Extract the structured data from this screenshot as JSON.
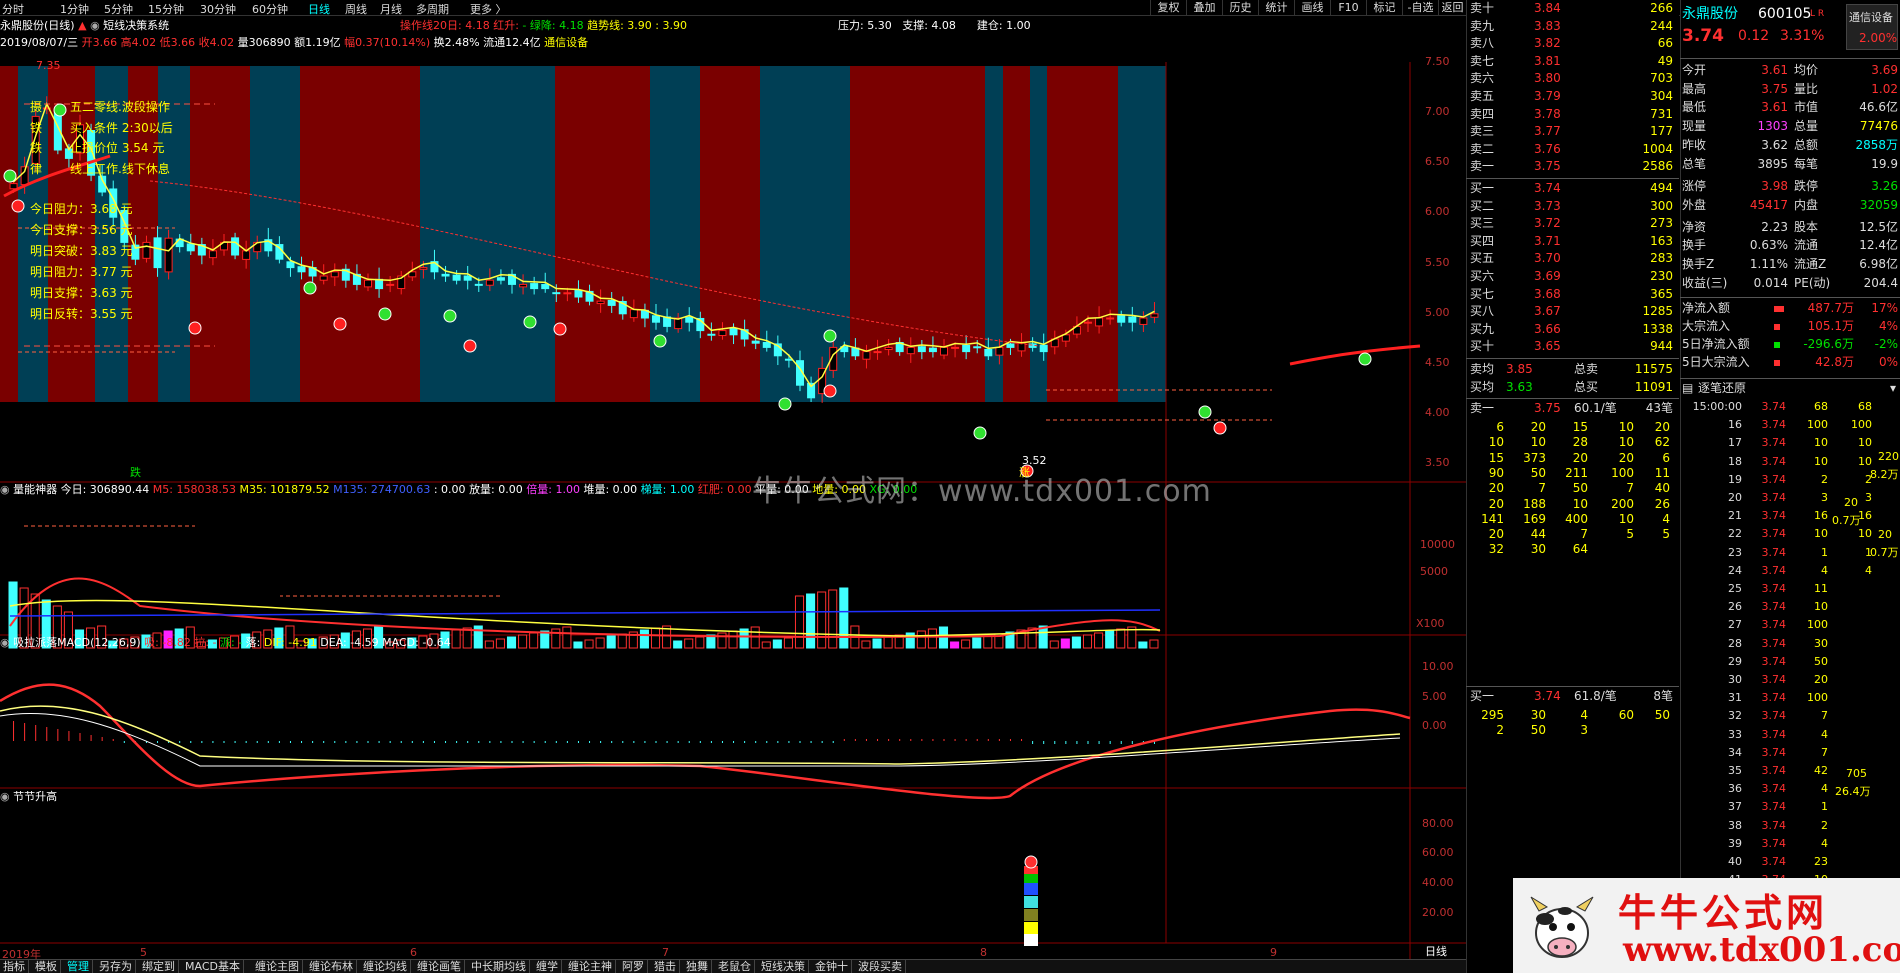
{
  "period_tabs": [
    "分时",
    "1分钟",
    "5分钟",
    "15分钟",
    "30分钟",
    "60分钟",
    "日线",
    "周线",
    "月线",
    "多周期",
    "更多 〉"
  ],
  "active_tab": "日线",
  "right_buttons": [
    "复权",
    "叠加",
    "历史",
    "统计",
    "画线",
    "F10",
    "标记",
    "-自选",
    "返回"
  ],
  "chart_title": {
    "stock": "永鼎股份(日线)",
    "indicator": "短线决策系统",
    "line1": "操作线20日: 4.18",
    "line2": "红升:",
    "line3": "- 绿降: 4.18",
    "line4": "趋势线: 3.90",
    "line5": ": 3.90",
    "pressure": "压力: 5.30",
    "support": "支撑: 4.08",
    "build": "建仓: 1.00"
  },
  "info_line": {
    "date": "2019/08/07/三",
    "open": "开3.66",
    "high": "高4.02",
    "low": "低3.66",
    "close": "收4.02",
    "vol": "量306890",
    "amt": "额1.19亿",
    "chg": "幅0.37(10.14%)",
    "turnover": "换2.48%",
    "circ": "流通12.4亿",
    "board": "通信设备"
  },
  "price_axis": [
    "7.50",
    "7.00",
    "6.50",
    "6.00",
    "5.50",
    "5.00",
    "4.50",
    "4.00",
    "3.50"
  ],
  "annotations": {
    "high": "7.35",
    "low": "3.52",
    "boxtitle": "五二零线.波段操作",
    "buy": "买入条件  2:30以后",
    "stop": "止损价位  3.54 元",
    "online": "线上工作.线下休息",
    "side": [
      "摄",
      "铁",
      "铁",
      "律"
    ],
    "die": "跌",
    "zhang": "涨"
  },
  "levels": [
    {
      "k": "今日阻力：",
      "v": "3.68 元"
    },
    {
      "k": "今日支撑：",
      "v": "3.56 元"
    },
    {
      "k": "明日突破：",
      "v": "3.83 元"
    },
    {
      "k": "明日阻力：",
      "v": "3.77 元"
    },
    {
      "k": "明日支撑：",
      "v": "3.63 元"
    },
    {
      "k": "明日反转：",
      "v": "3.55 元"
    }
  ],
  "vol_header": {
    "name": "量能神器",
    "today": "今日: 306890.44",
    "m5": "M5: 158038.53",
    "m35": "M35: 101879.52",
    "m135": "M135: 274700.63",
    "x1": ": 0.00",
    "fang": "放量: 0.00",
    "bei": "倍量: 1.00",
    "dui": "堆量: 0.00",
    "ti": "梯量: 1.00",
    "hong": "红肥: 0.00",
    "pq": "平量: 0.00",
    "xi": "地量: 0.00",
    "xg": "XG: 0.00"
  },
  "vol_axis": [
    "10000",
    "5000",
    "X100"
  ],
  "macd_header": {
    "name": "吸拉派落MACD(12,26,9)",
    "xi": "吸: -8.82",
    "la": "拉: -",
    "pai": "派: -",
    "luo": "落:",
    "dif": "DIF: -4.91",
    "dea": "DEA: -4.59",
    "macd": "MACD: -0.64"
  },
  "macd_axis": [
    "10.00",
    "5.00",
    "0.00"
  ],
  "jj_header": "节节升高",
  "jj_axis": [
    "80.00",
    "60.00",
    "40.00",
    "20.00"
  ],
  "time_axis": [
    "2019年",
    "5",
    "6",
    "7",
    "8",
    "9"
  ],
  "time_axis_label": "日线",
  "bottom_tabs": [
    "指标",
    "模板",
    "管理",
    "另存为",
    "绑定到",
    "MACD基本",
    "缠论主图",
    "缠论布林",
    "缠论均线",
    "缠论画笔",
    "中长期均线",
    "缠学",
    "缠论主神",
    "阿罗",
    "猎击",
    "独舞",
    "老鼠仓",
    "短线决策",
    "金钟十",
    "波段买卖"
  ],
  "ask_rows": [
    {
      "n": "卖十",
      "p": "3.84",
      "v": "266"
    },
    {
      "n": "卖九",
      "p": "3.83",
      "v": "244"
    },
    {
      "n": "卖八",
      "p": "3.82",
      "v": "66"
    },
    {
      "n": "卖七",
      "p": "3.81",
      "v": "49"
    },
    {
      "n": "卖六",
      "p": "3.80",
      "v": "703"
    },
    {
      "n": "卖五",
      "p": "3.79",
      "v": "304"
    },
    {
      "n": "卖四",
      "p": "3.78",
      "v": "731"
    },
    {
      "n": "卖三",
      "p": "3.77",
      "v": "177"
    },
    {
      "n": "卖二",
      "p": "3.76",
      "v": "1004"
    },
    {
      "n": "卖一",
      "p": "3.75",
      "v": "2586"
    }
  ],
  "bid_rows": [
    {
      "n": "买一",
      "p": "3.74",
      "v": "494"
    },
    {
      "n": "买二",
      "p": "3.73",
      "v": "300"
    },
    {
      "n": "买三",
      "p": "3.72",
      "v": "273"
    },
    {
      "n": "买四",
      "p": "3.71",
      "v": "163"
    },
    {
      "n": "买五",
      "p": "3.70",
      "v": "283"
    },
    {
      "n": "买六",
      "p": "3.69",
      "v": "230"
    },
    {
      "n": "买七",
      "p": "3.68",
      "v": "365"
    },
    {
      "n": "买八",
      "p": "3.67",
      "v": "1285"
    },
    {
      "n": "买九",
      "p": "3.66",
      "v": "1338"
    },
    {
      "n": "买十",
      "p": "3.65",
      "v": "944"
    }
  ],
  "avg_rows": [
    {
      "a": "卖均",
      "b": "3.85",
      "c": "总卖",
      "d": "11575"
    },
    {
      "a": "买均",
      "b": "3.63",
      "c": "总买",
      "d": "11091"
    }
  ],
  "sell1_header": {
    "a": "卖一",
    "b": "3.75",
    "c": "60.1/笔",
    "d": "43笔"
  },
  "sell1_grid": [
    [
      "6",
      "20",
      "15",
      "10",
      "20"
    ],
    [
      "10",
      "10",
      "28",
      "10",
      "62"
    ],
    [
      "15",
      "373",
      "20",
      "20",
      "6"
    ],
    [
      "90",
      "50",
      "211",
      "100",
      "11"
    ],
    [
      "20",
      "7",
      "50",
      "7",
      "40"
    ],
    [
      "20",
      "188",
      "10",
      "200",
      "26"
    ],
    [
      "141",
      "169",
      "400",
      "10",
      "4"
    ],
    [
      "20",
      "44",
      "7",
      "5",
      "5"
    ],
    [
      "32",
      "30",
      "64",
      "",
      ""
    ]
  ],
  "buy1_header": {
    "a": "买一",
    "b": "3.74",
    "c": "61.8/笔",
    "d": "8笔"
  },
  "buy1_grid": [
    [
      "295",
      "30",
      "4",
      "60",
      "50"
    ],
    [
      "2",
      "50",
      "3",
      "",
      ""
    ]
  ],
  "quote": {
    "name": "永鼎股份",
    "code": "600105",
    "lr": "L R",
    "price": "3.74",
    "chg": "0.12",
    "pct": "3.31%",
    "sector": "通信设备",
    "sector_pct": "2.00%"
  },
  "stats": [
    {
      "a": "今开",
      "b": "3.61",
      "c": "均价",
      "d": "3.69"
    },
    {
      "a": "最高",
      "b": "3.75",
      "c": "量比",
      "d": "1.02"
    },
    {
      "a": "最低",
      "b": "3.61",
      "c": "市值",
      "d": "46.6亿"
    },
    {
      "a": "现量",
      "b": "1303",
      "c": "总量",
      "d": "77476"
    },
    {
      "a": "昨收",
      "b": "3.62",
      "c": "总额",
      "d": "2858万"
    },
    {
      "a": "总笔",
      "b": "3895",
      "c": "每笔",
      "d": "19.9"
    },
    {
      "a": "涨停",
      "b": "3.98",
      "c": "跌停",
      "d": "3.26"
    },
    {
      "a": "外盘",
      "b": "45417",
      "c": "内盘",
      "d": "32059"
    },
    {
      "a": "净资",
      "b": "2.23",
      "c": "股本",
      "d": "12.5亿"
    },
    {
      "a": "换手",
      "b": "0.63%",
      "c": "流通",
      "d": "12.4亿"
    },
    {
      "a": "换手Z",
      "b": "1.11%",
      "c": "流通Z",
      "d": "6.98亿"
    },
    {
      "a": "收益(三)",
      "b": "0.014",
      "c": "PE(动)",
      "d": "204.4"
    }
  ],
  "flows": [
    {
      "a": "净流入额",
      "b": "487.7万",
      "c": "17%"
    },
    {
      "a": "大宗流入",
      "b": "105.1万",
      "c": "4%"
    },
    {
      "a": "5日净流入额",
      "b": "-296.6万",
      "c": "-2%"
    },
    {
      "a": "5日大宗流入",
      "b": "42.8万",
      "c": "0%"
    }
  ],
  "tick_title": "逐笔还原",
  "tick_rows": [
    [
      "15:00:00",
      "3.74",
      "68",
      "68"
    ],
    [
      "16",
      "3.74",
      "100",
      "100"
    ],
    [
      "17",
      "3.74",
      "10",
      "10"
    ],
    [
      "18",
      "3.74",
      "10",
      "10"
    ],
    [
      "19",
      "3.74",
      "2",
      "2"
    ],
    [
      "20",
      "3.74",
      "3",
      "3"
    ],
    [
      "21",
      "3.74",
      "16",
      "16"
    ],
    [
      "22",
      "3.74",
      "10",
      "10"
    ],
    [
      "23",
      "3.74",
      "1",
      "1"
    ],
    [
      "24",
      "3.74",
      "4",
      "4"
    ],
    [
      "25",
      "3.74",
      "11",
      ""
    ],
    [
      "26",
      "3.74",
      "10",
      ""
    ],
    [
      "27",
      "3.74",
      "100",
      ""
    ],
    [
      "28",
      "3.74",
      "30",
      ""
    ],
    [
      "29",
      "3.74",
      "50",
      ""
    ],
    [
      "30",
      "3.74",
      "20",
      ""
    ],
    [
      "31",
      "3.74",
      "100",
      ""
    ],
    [
      "32",
      "3.74",
      "7",
      ""
    ],
    [
      "33",
      "3.74",
      "4",
      ""
    ],
    [
      "34",
      "3.74",
      "7",
      ""
    ],
    [
      "35",
      "3.74",
      "42",
      ""
    ],
    [
      "36",
      "3.74",
      "4",
      ""
    ],
    [
      "37",
      "3.74",
      "1",
      ""
    ],
    [
      "38",
      "3.74",
      "2",
      ""
    ],
    [
      "39",
      "3.74",
      "4",
      ""
    ],
    [
      "40",
      "3.74",
      "23",
      ""
    ],
    [
      "41",
      "3.74",
      "10",
      ""
    ],
    [
      "42",
      "3.74",
      "34",
      ""
    ],
    [
      "43",
      "3.74",
      "20",
      ""
    ],
    [
      "44",
      "3.74",
      "3",
      ""
    ],
    [
      "45",
      "3.74",
      "20",
      ""
    ]
  ],
  "tick_side": {
    "a": "220",
    "b": "8.2万",
    "c": "20",
    "d": "0.7万",
    "e": "20",
    "f": "0.7万",
    "g": "705",
    "h": "26.4万"
  },
  "watermark_center": "牛牛公式网：www.tdx001.com",
  "logo": {
    "cn": "牛牛公式网",
    "url": "www.tdx001.com"
  }
}
